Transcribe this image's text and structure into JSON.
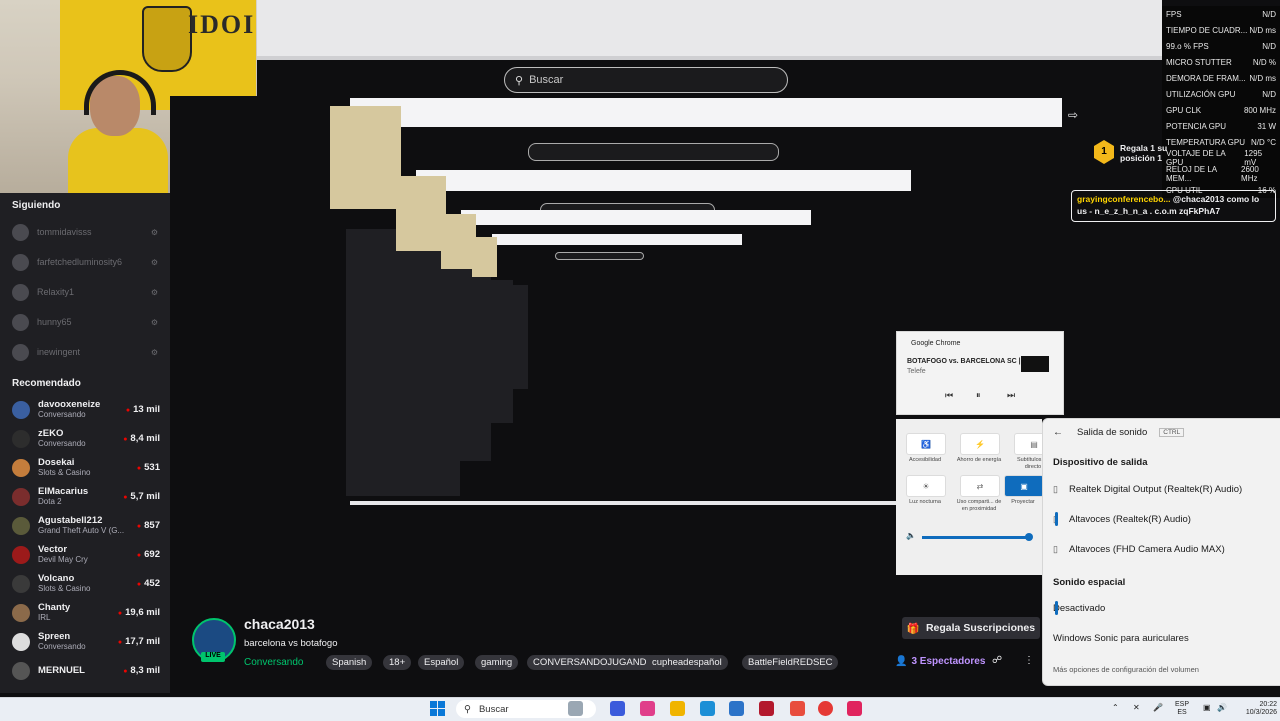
{
  "webcam": {
    "flag_text": "IDOI"
  },
  "browser": {
    "search_placeholder": "Buscar"
  },
  "fps_overlay": {
    "rows": [
      {
        "label": "FPS",
        "value": "N/D"
      },
      {
        "label": "TIEMPO DE CUADR...",
        "value": "N/D ms"
      },
      {
        "label": "99.o % FPS",
        "value": "N/D"
      },
      {
        "label": "MICRO STUTTER",
        "value": "N/D %"
      },
      {
        "label": "DEMORA DE FRAM...",
        "value": "N/D ms"
      },
      {
        "label": "UTILIZACIÓN GPU",
        "value": "N/D"
      },
      {
        "label": "GPU CLK",
        "value": "800 MHz"
      },
      {
        "label": "POTENCIA GPU",
        "value": "31 W"
      },
      {
        "label": "TEMPERATURA GPU",
        "value": "N/D °C"
      },
      {
        "label": "VOLTAJE DE LA GPU",
        "value": "1295 mV"
      },
      {
        "label": "RELOJ DE LA MEM...",
        "value": "2600 MHz"
      },
      {
        "label": "CPU UTIL",
        "value": "16 %"
      }
    ]
  },
  "sidebar": {
    "following_title": "Siguiendo",
    "following": [
      "tommidavisss",
      "farfetchedluminosity6",
      "Relaxity1",
      "hunny65",
      "inewingent"
    ],
    "recommended_title": "Recomendado",
    "recommended": [
      {
        "name": "davooxeneize",
        "game": "Conversando",
        "viewers": "13 mil"
      },
      {
        "name": "zEKO",
        "game": "Conversando",
        "viewers": "8,4 mil"
      },
      {
        "name": "Dosekai",
        "game": "Slots & Casino",
        "viewers": "531"
      },
      {
        "name": "ElMacarius",
        "game": "Dota 2",
        "viewers": "5,7 mil"
      },
      {
        "name": "Agustabell212",
        "game": "Grand Theft Auto V (G...",
        "viewers": "857"
      },
      {
        "name": "Vector",
        "game": "Devil May Cry",
        "viewers": "692"
      },
      {
        "name": "Volcano",
        "game": "Slots & Casino",
        "viewers": "452"
      },
      {
        "name": "Chanty",
        "game": "IRL",
        "viewers": "19,6 mil"
      },
      {
        "name": "Spreen",
        "game": "Conversando",
        "viewers": "17,7 mil"
      },
      {
        "name": "MERNUEL",
        "game": "",
        "viewers": "8,3 mil"
      }
    ]
  },
  "stream": {
    "channel": "chaca2013",
    "live": "LIVE",
    "title": "barcelona vs botafogo",
    "category": "Conversando",
    "tags": [
      "Spanish",
      "18+",
      "Español",
      "gaming",
      "CONVERSANDOJUGANDO",
      "cupheadespañol",
      "BattleFieldREDSEC"
    ],
    "subscribe_label": "Regala Suscripciones",
    "viewers_label": "3 Espectadores"
  },
  "chat": {
    "gift_number": "1",
    "gift_text": "Regala 1 su",
    "gift_sub": "posición 1",
    "message_user": "grayingconferencebo...",
    "message_text": "@chaca2013 como lo us - n_e_z_h_n_a . c.o.m zqFkPhA7"
  },
  "media_flyout": {
    "app": "Google Chrome",
    "title": "BOTAFOGO vs. BARCELONA SC | CO...",
    "subtitle": "Telefe"
  },
  "quick_settings": {
    "labels": [
      "Accesibilidad",
      "Ahorro de energía",
      "Subtítulos en directo",
      "Luz nocturna",
      "Uso comparti... de en proximidad",
      "Proyectar"
    ]
  },
  "sound_flyout": {
    "title": "Salida de sonido",
    "shortcut": "CTRL",
    "output_section": "Dispositivo de salida",
    "devices": [
      "Realtek Digital Output (Realtek(R) Audio)",
      "Altavoces (Realtek(R) Audio)",
      "Altavoces (FHD Camera Audio MAX)"
    ],
    "spatial_section": "Sonido espacial",
    "spatial_options": [
      "Desactivado",
      "Windows Sonic para auriculares"
    ],
    "more_link": "Más opciones de configuración del volumen"
  },
  "taskbar": {
    "search_placeholder": "Buscar",
    "lang": "ESP",
    "lang_sub": "ES",
    "time": "20:22",
    "date": "10/3/2026"
  },
  "colors": {
    "twitch_purple": "#bf94ff",
    "live_red": "#eb0400",
    "windows_accent": "#0f6cbd"
  }
}
